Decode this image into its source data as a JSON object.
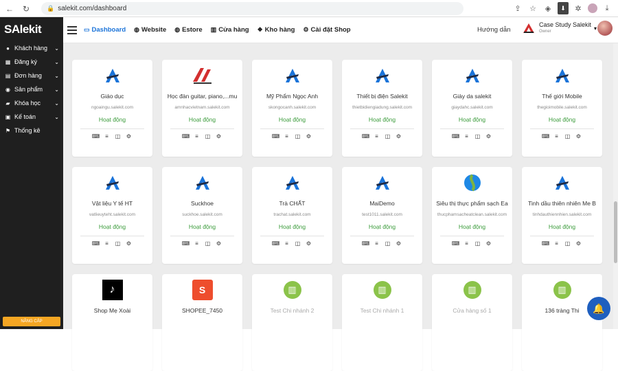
{
  "browser": {
    "url": "salekit.com/dashboard"
  },
  "sidebar": {
    "logo": "SAlekit",
    "items": [
      {
        "label": "Khách hàng",
        "icon": "user-icon"
      },
      {
        "label": "Đăng ký",
        "icon": "register-icon"
      },
      {
        "label": "Đơn hàng",
        "icon": "cart-icon"
      },
      {
        "label": "Sản phẩm",
        "icon": "product-icon"
      },
      {
        "label": "Khóa học",
        "icon": "course-icon"
      },
      {
        "label": "Kế toán",
        "icon": "accounting-icon"
      },
      {
        "label": "Thống kê",
        "icon": "stats-icon"
      }
    ],
    "upgrade_label": "NÂNG CẤP"
  },
  "topnav": {
    "links": [
      {
        "label": "Dashboard",
        "icon": "monitor-icon",
        "active": true
      },
      {
        "label": "Website",
        "icon": "globe-icon",
        "active": false
      },
      {
        "label": "Estore",
        "icon": "globe-icon",
        "active": false
      },
      {
        "label": "Cửa hàng",
        "icon": "store-icon",
        "active": false
      },
      {
        "label": "Kho hàng",
        "icon": "warehouse-icon",
        "active": false
      },
      {
        "label": "Cài đặt Shop",
        "icon": "gear-icon",
        "active": false
      }
    ],
    "guide": "Hướng dẫn",
    "shop_name": "Case Study Salekit",
    "shop_role": "Owner"
  },
  "cards": [
    {
      "name": "Giáo dục",
      "domain": "ngoaingu.salekit.com",
      "status": "Hoạt động",
      "logo": "salekit-logo"
    },
    {
      "name": "Học đàn guitar, piano,...mu",
      "domain": "amnhacvietnam.salekit.com",
      "status": "Hoạt động",
      "logo": "music-logo"
    },
    {
      "name": "Mỹ Phẩm Ngọc Anh",
      "domain": "skongocanh.salekit.com",
      "status": "Hoạt động",
      "logo": "salekit-logo"
    },
    {
      "name": "Thiết bị điện Salekit",
      "domain": "thietbidiengiadung.salekit.com",
      "status": "Hoạt động",
      "logo": "salekit-logo"
    },
    {
      "name": "Giày da salekit",
      "domain": "giaydahc.salekit.com",
      "status": "Hoạt động",
      "logo": "salekit-logo"
    },
    {
      "name": "Thế giới Mobile",
      "domain": "thegioimobile.salekit.com",
      "status": "Hoạt động",
      "logo": "salekit-logo"
    },
    {
      "name": "Vật liệu Y tế HT",
      "domain": "vatlieuyteht.salekit.com",
      "status": "Hoạt động",
      "logo": "salekit-logo"
    },
    {
      "name": "Suckhoe",
      "domain": "suckhoe.salekit.com",
      "status": "Hoạt động",
      "logo": "salekit-logo"
    },
    {
      "name": "Trà CHẤT",
      "domain": "trachat.salekit.com",
      "status": "Hoạt động",
      "logo": "salekit-logo"
    },
    {
      "name": "MaiDemo",
      "domain": "test1011.salekit.com",
      "status": "Hoạt động",
      "logo": "salekit-logo"
    },
    {
      "name": "Siêu thị thực phẩm sạch Ea",
      "domain": "thucphamsacheatclean.salekit.com",
      "status": "Hoạt động",
      "logo": "clean-food-logo"
    },
    {
      "name": "Tinh dầu thiên nhiên Me B",
      "domain": "tinhdauthiennhien.salekit.com",
      "status": "Hoạt động",
      "logo": "salekit-logo"
    },
    {
      "name": "Shop Mẹ Xoài",
      "domain": "",
      "status": "",
      "logo": "tiktok-logo"
    },
    {
      "name": "SHOPEE_7450",
      "domain": "",
      "status": "",
      "logo": "shopee-logo"
    },
    {
      "name": "Test Chi nhánh 2",
      "domain": "",
      "status": "",
      "logo": "store-logo",
      "dim": true
    },
    {
      "name": "Test Chi nhánh 1",
      "domain": "",
      "status": "",
      "logo": "store-logo",
      "dim": true
    },
    {
      "name": "Cửa hàng số 1",
      "domain": "",
      "status": "",
      "logo": "store-logo",
      "dim": true
    },
    {
      "name": "136 tràng Thi",
      "domain": "",
      "status": "",
      "logo": "store-logo"
    }
  ],
  "colors": {
    "accent": "#1a73d9",
    "status_active": "#3a9b3a",
    "sidebar_bg": "#1f1f1f",
    "upgrade": "#f5a623"
  }
}
